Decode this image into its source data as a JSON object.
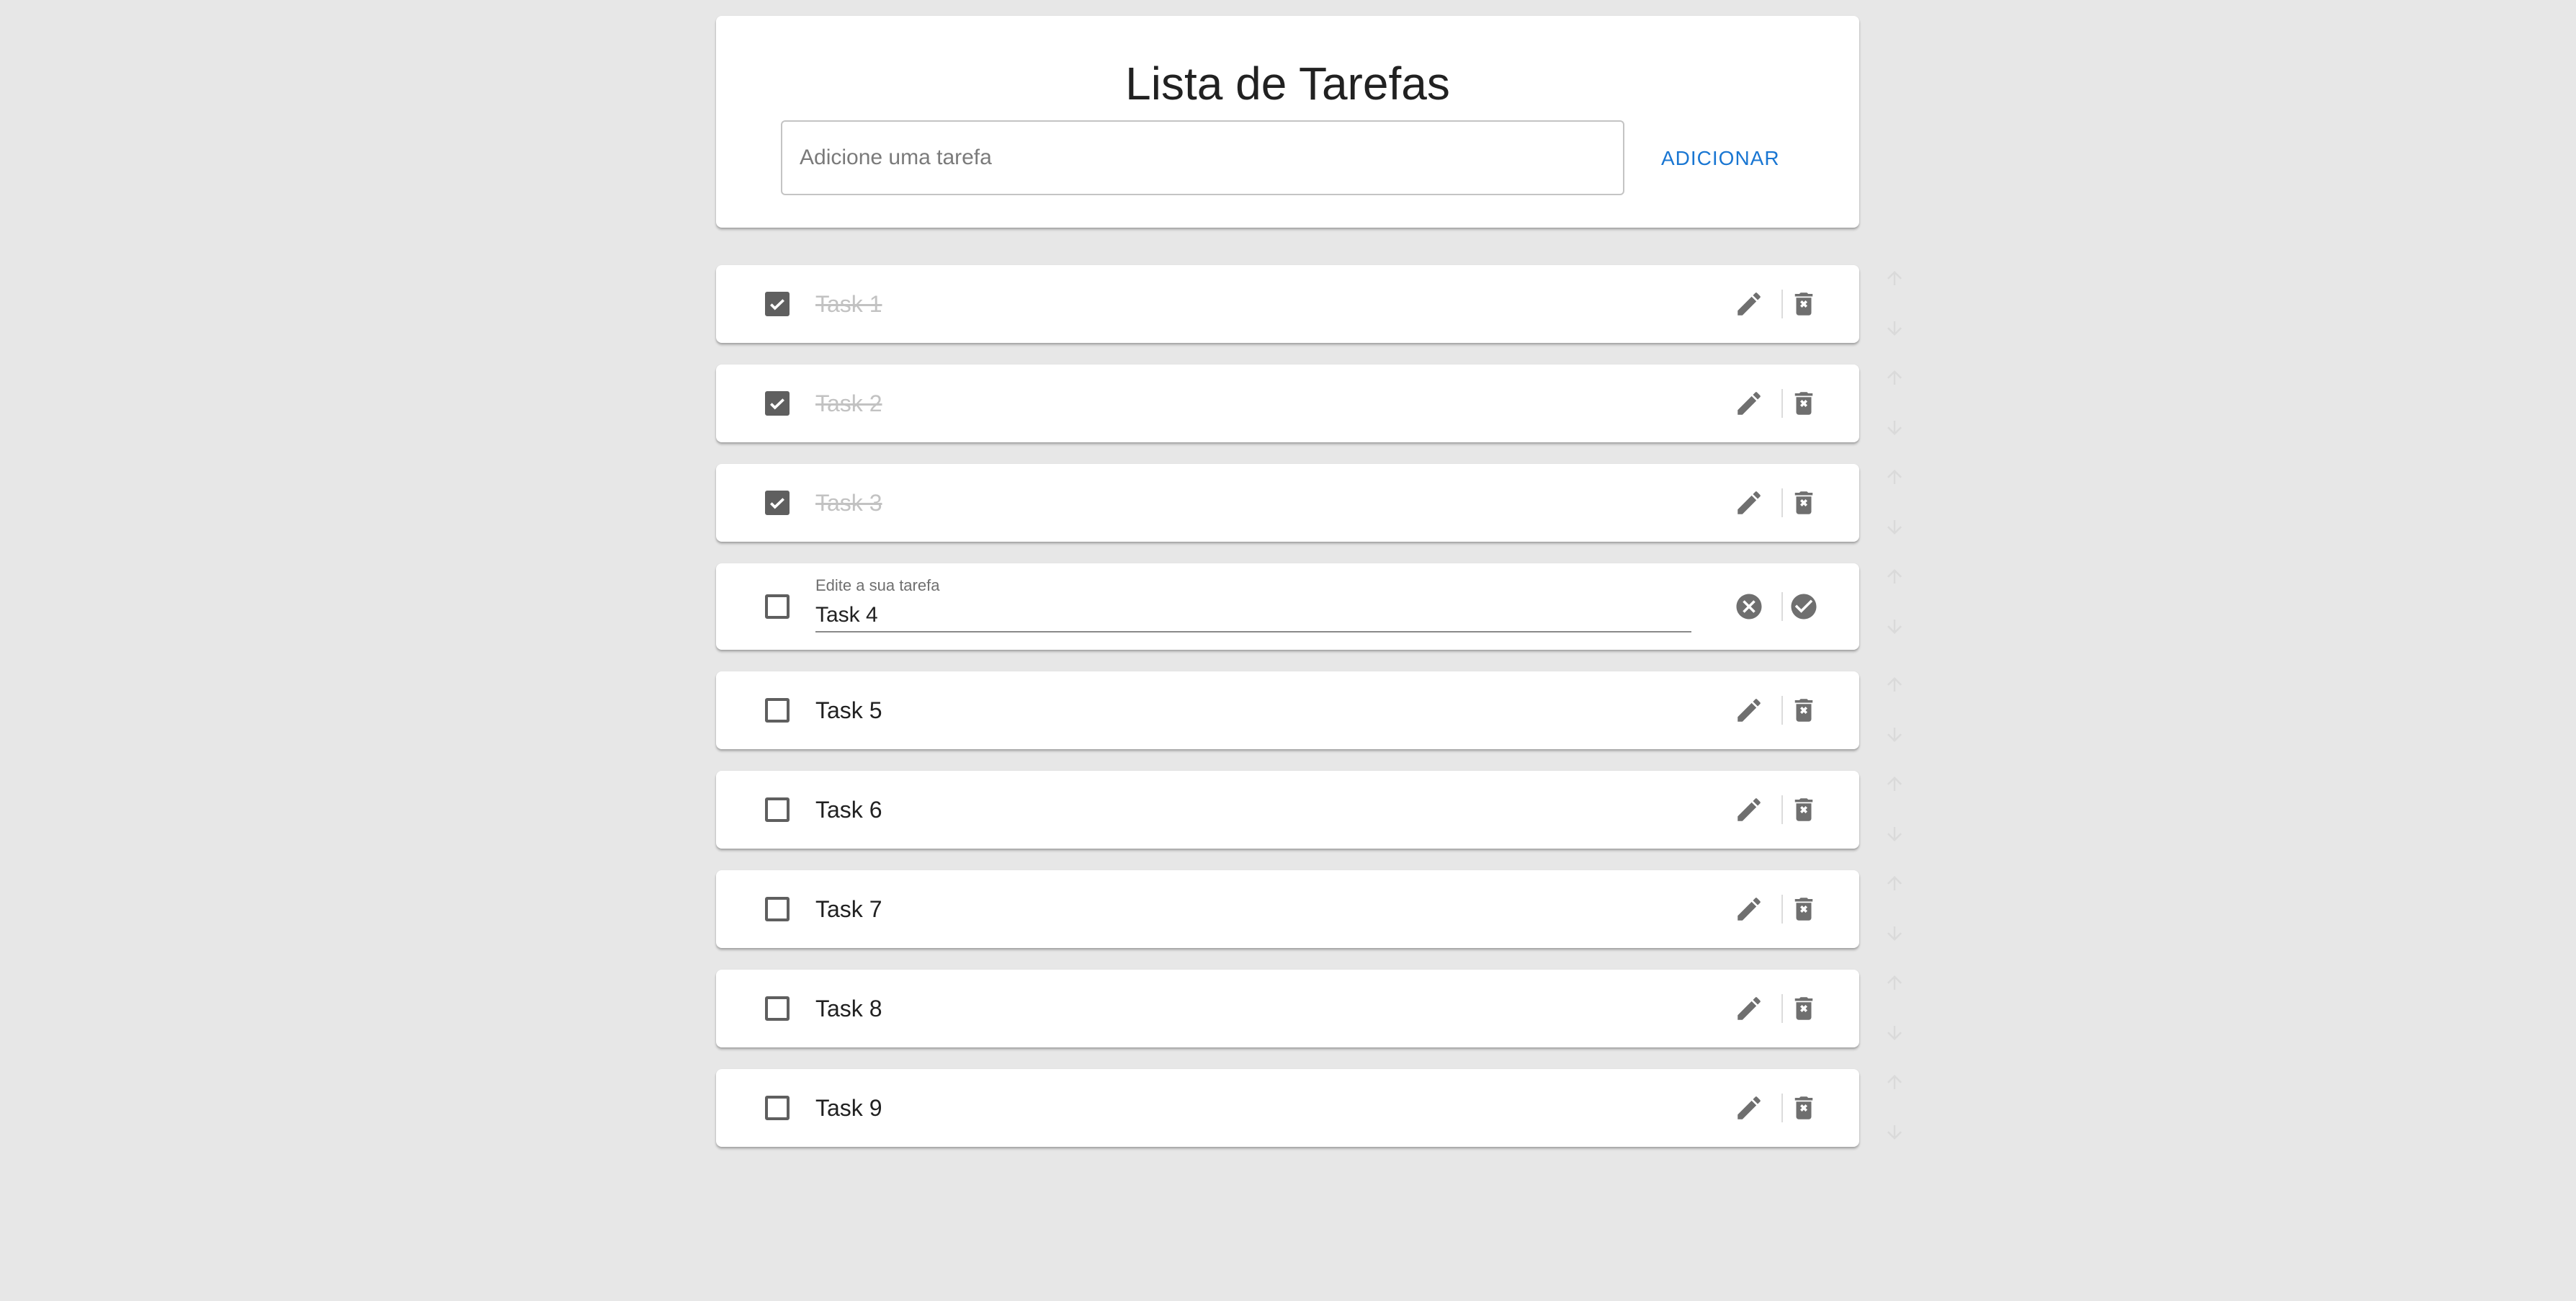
{
  "header": {
    "title": "Lista de Tarefas",
    "input_placeholder": "Adicione uma tarefa",
    "input_value": "",
    "add_label": "ADICIONAR"
  },
  "colors": {
    "background": "#e7e7e7",
    "accent": "#1976d2",
    "icon": "#6f6f6f",
    "done_text": "#c2c2c2"
  },
  "edit_caption": "Edite a sua tarefa",
  "tasks": [
    {
      "label": "Task 1",
      "done": true,
      "editing": false
    },
    {
      "label": "Task 2",
      "done": true,
      "editing": false
    },
    {
      "label": "Task 3",
      "done": true,
      "editing": false
    },
    {
      "label": "Task 4",
      "done": false,
      "editing": true
    },
    {
      "label": "Task 5",
      "done": false,
      "editing": false
    },
    {
      "label": "Task 6",
      "done": false,
      "editing": false
    },
    {
      "label": "Task 7",
      "done": false,
      "editing": false
    },
    {
      "label": "Task 8",
      "done": false,
      "editing": false
    },
    {
      "label": "Task 9",
      "done": false,
      "editing": false
    }
  ],
  "icons": {
    "edit": "pencil-icon",
    "delete": "trash-icon",
    "cancel": "cancel-circle-icon",
    "confirm": "check-circle-icon",
    "move_up": "arrow-up-icon",
    "move_down": "arrow-down-icon"
  }
}
